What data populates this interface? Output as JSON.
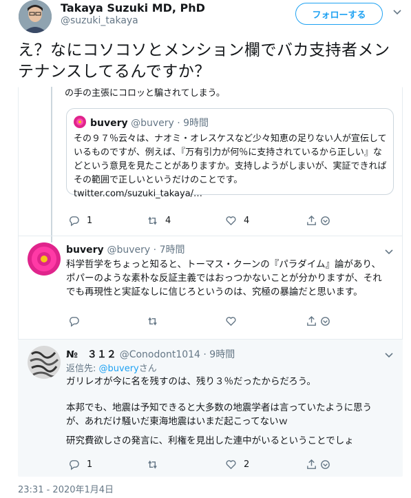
{
  "author": {
    "name": "Takaya Suzuki MD, PhD",
    "handle": "@suzuki_takaya",
    "follow_label": "フォローする"
  },
  "tweet": {
    "text": "え？なにコソコソとメンション欄でバカ支持者メンテナンスしてるんですか？",
    "timestamp": "23:31 - 2020年1月4日"
  },
  "embedded": {
    "cut_text": "の手の主張にコロッと騙されてしまう。",
    "quote": {
      "name": "buvery",
      "handle_time": "@buvery · 9時間",
      "body": "その９７％云々は、ナオミ・オレスケスなど少々知恵の足りない人が宣伝しているものですが、例えば、『万有引力が何％に支持されているから正しい』などという意見を見たことがありますか。支持しようがしまいが、実証できればその範囲で正しいというだけのことです。",
      "link": "twitter.com/suzuki_takaya/…"
    },
    "actions": {
      "reply": "1",
      "retweet": "4",
      "like": "4"
    }
  },
  "reply1": {
    "name": "buvery",
    "handle_time": "@buvery · 7時間",
    "body": "科学哲学をちょっと知ると、トーマス・クーンの『パラダイム』論があり、ポパーのような素朴な反証主義ではおっつかないことが分かりますが、それでも再現性と実証なしに信じろというのは、究極の暴論だと思います。"
  },
  "reply2": {
    "name": "№　３１２",
    "handle_time": "@Conodont1014 · 9時間",
    "reply_prefix": "返信先: ",
    "reply_user": "@buvery",
    "reply_suffix": "さん",
    "line1": "ガリレオが今に名を残すのは、残り３％だったからだろう。",
    "line2": "本邦でも、地震は予知できると大多数の地震学者は言っていたように思うが、あれだけ騒いだ東海地震はいまだ起こってないｗ",
    "line3": "研究費欲しさの発言に、利権を見出した連中がいるということでしょ",
    "actions": {
      "reply": "1",
      "like": "2"
    }
  }
}
